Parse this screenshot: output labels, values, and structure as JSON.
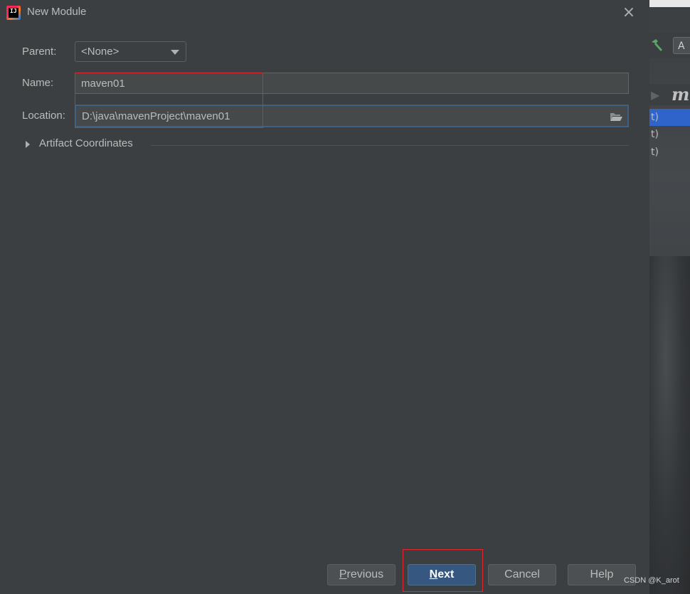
{
  "dialog": {
    "title": "New Module",
    "close_glyph": "×"
  },
  "form": {
    "parent_label": "Parent:",
    "parent_value": "<None>",
    "name_label": "Name:",
    "name_value": "maven01",
    "location_label": "Location:",
    "location_value": "D:\\java\\mavenProject\\maven01"
  },
  "artifact": {
    "label": "Artifact Coordinates",
    "expanded": false
  },
  "buttons": {
    "previous_mnemonic": "P",
    "previous_rest": "revious",
    "next_mnemonic": "N",
    "next_rest": "ext",
    "cancel": "Cancel",
    "help": "Help"
  },
  "background_ide": {
    "add_button_label": "A",
    "maven_icon_glyph": "m",
    "rows": [
      "t)",
      "t)",
      "t)"
    ]
  },
  "watermark": "CSDN @K_arot",
  "colors": {
    "dialog_bg": "#3c3f41",
    "input_bg": "#45494a",
    "primary_button": "#365880",
    "focus_border": "#3d6185",
    "highlight_box": "#e0262e",
    "text": "#bbbbbb"
  },
  "icons": {
    "app": "intellij-idea-icon",
    "close": "close-icon",
    "dropdown": "chevron-down-icon",
    "browse": "folder-open-icon",
    "expand": "triangle-right-icon"
  }
}
